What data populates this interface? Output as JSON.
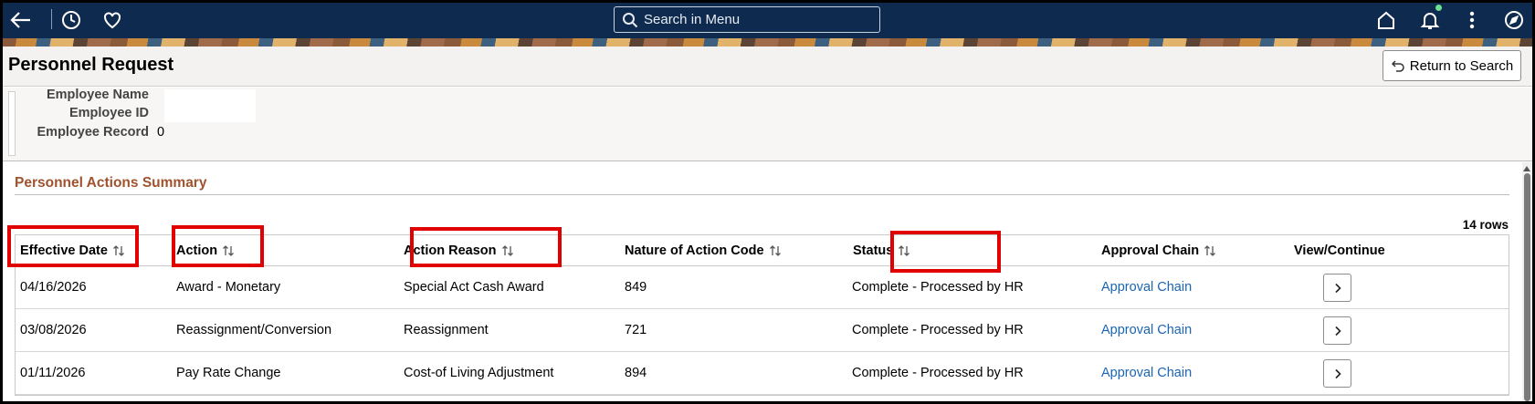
{
  "nav": {
    "search_placeholder": "Search in Menu"
  },
  "page": {
    "title": "Personnel Request",
    "return_label": "Return to Search"
  },
  "employee": {
    "name_label": "Employee Name",
    "id_label": "Employee ID",
    "record_label": "Employee Record",
    "record_value": "0"
  },
  "summary": {
    "section_title": "Personnel Actions Summary",
    "row_count": "14 rows",
    "columns": [
      "Effective Date",
      "Action",
      "Action Reason",
      "Nature of Action Code",
      "Status",
      "Approval Chain",
      "View/Continue"
    ],
    "rows": [
      {
        "date": "04/16/2026",
        "action": "Award - Monetary",
        "reason": "Special Act Cash Award",
        "noa": "849",
        "status": "Complete - Processed by HR",
        "chain": "Approval Chain"
      },
      {
        "date": "03/08/2026",
        "action": "Reassignment/Conversion",
        "reason": "Reassignment",
        "noa": "721",
        "status": "Complete - Processed by HR",
        "chain": "Approval Chain"
      },
      {
        "date": "01/11/2026",
        "action": "Pay Rate Change",
        "reason": "Cost-of Living Adjustment",
        "noa": "894",
        "status": "Complete - Processed by HR",
        "chain": "Approval Chain"
      }
    ]
  },
  "colors": {
    "navbar": "#0f2a4f",
    "section_title": "#a0522d",
    "link": "#1a65b5",
    "highlight": "#e10000"
  }
}
